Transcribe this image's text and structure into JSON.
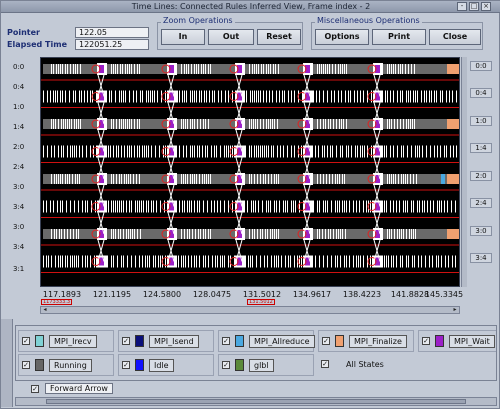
{
  "window": {
    "title": "Time Lines: Connected Rules Inferred View, Frame index - 2",
    "controls": [
      "-",
      "□",
      "×"
    ]
  },
  "header": {
    "pointer_label": "Pointer",
    "pointer_value": "122.05",
    "elapsed_label": "Elapsed Time",
    "elapsed_value": "122051.25",
    "zoom_group_title": "Zoom Operations",
    "zoom_in": "In",
    "zoom_out": "Out",
    "zoom_reset": "Reset",
    "misc_group_title": "Miscellaneous Operations",
    "options": "Options",
    "print": "Print",
    "close": "Close"
  },
  "timeline": {
    "y_labels": [
      "0:0",
      "0:4",
      "1:0",
      "1:4",
      "2:0",
      "2:4",
      "3:0",
      "3:4",
      "3:0",
      "3:4",
      "3:1"
    ],
    "right_labels": [
      "0:0",
      "0:4",
      "1:0",
      "1:4",
      "2:0",
      "2:4",
      "3:0",
      "3:4"
    ],
    "x_ticks": [
      "117.1893",
      "121.1195",
      "124.5800",
      "128.0475",
      "131.5012",
      "134.9617",
      "138.4223",
      "141.8828",
      "145.3345"
    ],
    "marker_left": "1173333.3",
    "marker_mid": "131.5012"
  },
  "legend": {
    "items": [
      {
        "name": "MPI_Irecv",
        "color": "#7fd1d4"
      },
      {
        "name": "MPI_Isend",
        "color": "#0a0f7a"
      },
      {
        "name": "MPI_Allreduce",
        "color": "#4aa8e0"
      },
      {
        "name": "MPI_Finalize",
        "color": "#f0a070"
      },
      {
        "name": "MPI_Wait",
        "color": "#9b20c8"
      },
      {
        "name": "Running",
        "color": "#666666"
      },
      {
        "name": "Idle",
        "color": "#1010ff"
      },
      {
        "name": "glbl",
        "color": "#5a8a3a"
      }
    ],
    "all_states": "All States",
    "arrow_label": "Forward Arrow"
  }
}
